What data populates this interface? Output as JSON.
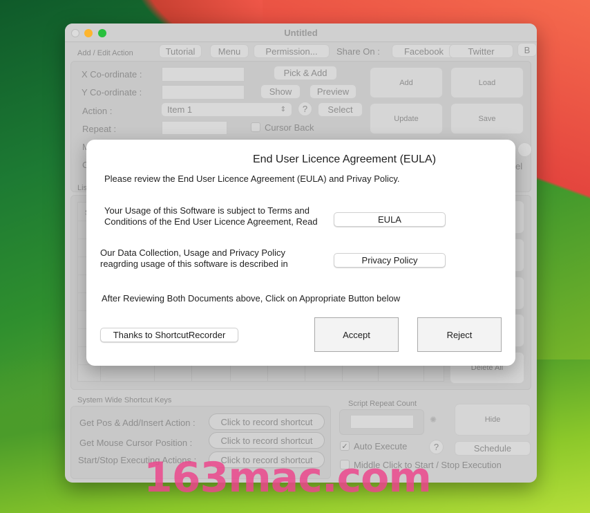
{
  "window": {
    "title": "Untitled"
  },
  "toolbar": {
    "section_label": "Add / Edit Action",
    "tutorial": "Tutorial",
    "menu": "Menu",
    "permission": "Permission...",
    "share_on": "Share On :",
    "facebook": "Facebook",
    "twitter": "Twitter",
    "b": "B"
  },
  "form": {
    "x_label": "X Co-ordinate :",
    "y_label": "Y Co-ordinate :",
    "action_label": "Action :",
    "repeat_label": "Repeat :",
    "m_label": "M",
    "c_label": "C",
    "x_value": "",
    "y_value": "",
    "repeat_value": "",
    "action_selected": "Item 1",
    "pick_add": "Pick & Add",
    "show": "Show",
    "preview": "Preview",
    "help": "?",
    "select": "Select",
    "cursor_back": "Cursor Back",
    "cursor_back_checked": false,
    "add": "Add",
    "load": "Load",
    "update": "Update",
    "save": "Save",
    "partial_el": "el"
  },
  "list": {
    "label": "Lis",
    "header_partial": "S",
    "delete_all": "Delete All"
  },
  "shortcuts": {
    "section_label": "System Wide Shortcut Keys",
    "rows": [
      {
        "label": "Get Pos & Add/Insert Action :",
        "button": "Click to record shortcut"
      },
      {
        "label": "Get Mouse Cursor Position :",
        "button": "Click to record shortcut"
      },
      {
        "label": "Start/Stop Executing Actions :",
        "button": "Click to record shortcut"
      }
    ]
  },
  "execution": {
    "script_repeat_label": "Script Repeat Count",
    "script_repeat_value": "",
    "hide": "Hide",
    "auto_execute": "Auto Execute",
    "auto_execute_checked": true,
    "check_mark": "✓",
    "help": "?",
    "schedule": "Schedule",
    "middle_click": "Middle Click to Start / Stop Execution",
    "middle_click_checked": false
  },
  "modal": {
    "title": "End User Licence Agreement (EULA)",
    "intro": "Please review the End User Licence Agreement (EULA) and Privay Policy.",
    "eula_text_1": "Your Usage of this Software is subject to Terms and",
    "eula_text_2": "Conditions of the End User Licence Agreement, Read",
    "eula_button": "EULA",
    "privacy_text_1": "Our Data Collection, Usage and Privacy Policy",
    "privacy_text_2": "reagrding usage of this software is described in",
    "privacy_button": "Privacy Policy",
    "instruction": "After Reviewing Both Documents above, Click on Appropriate Button below",
    "thanks_button": "Thanks to ShortcutRecorder",
    "accept": "Accept",
    "reject": "Reject"
  },
  "watermark": "163mac.com"
}
